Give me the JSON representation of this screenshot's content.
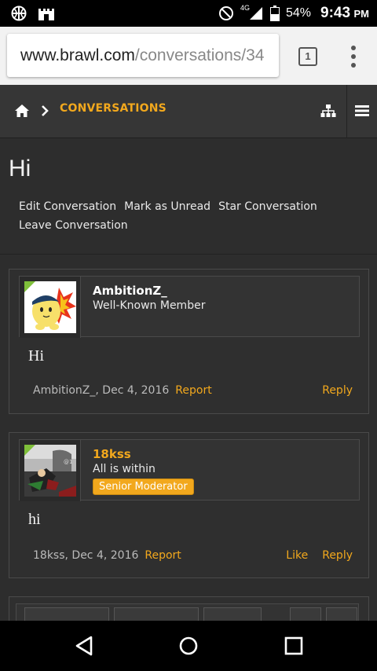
{
  "status_bar": {
    "network": "4G",
    "battery": "54%",
    "time": "9:43",
    "ampm": "PM",
    "icons": [
      "basketball-icon",
      "castle-icon",
      "do-not-disturb-icon",
      "signal-icon",
      "battery-icon"
    ]
  },
  "browser": {
    "url_host": "www.brawl.com",
    "url_path": "/conversations/34",
    "tab_count": "1"
  },
  "site_nav": {
    "breadcrumb": "CONVERSATIONS",
    "accent_color": "#f2a81d"
  },
  "page": {
    "title": "Hi",
    "actions": [
      "Edit Conversation",
      "Mark as Unread",
      "Star Conversation",
      "Leave Conversation"
    ]
  },
  "messages": [
    {
      "username": "AmbitionZ_",
      "user_title": "Well-Known Member",
      "body": "Hi",
      "meta": "AmbitionZ_, Dec 4, 2016",
      "report_label": "Report",
      "reply_label": "Reply"
    },
    {
      "username": "18kss",
      "user_title": "All is within",
      "badge": "Senior Moderator",
      "body": "hi",
      "meta": "18kss, Dec 4, 2016",
      "report_label": "Report",
      "like_label": "Like",
      "reply_label": "Reply"
    }
  ]
}
